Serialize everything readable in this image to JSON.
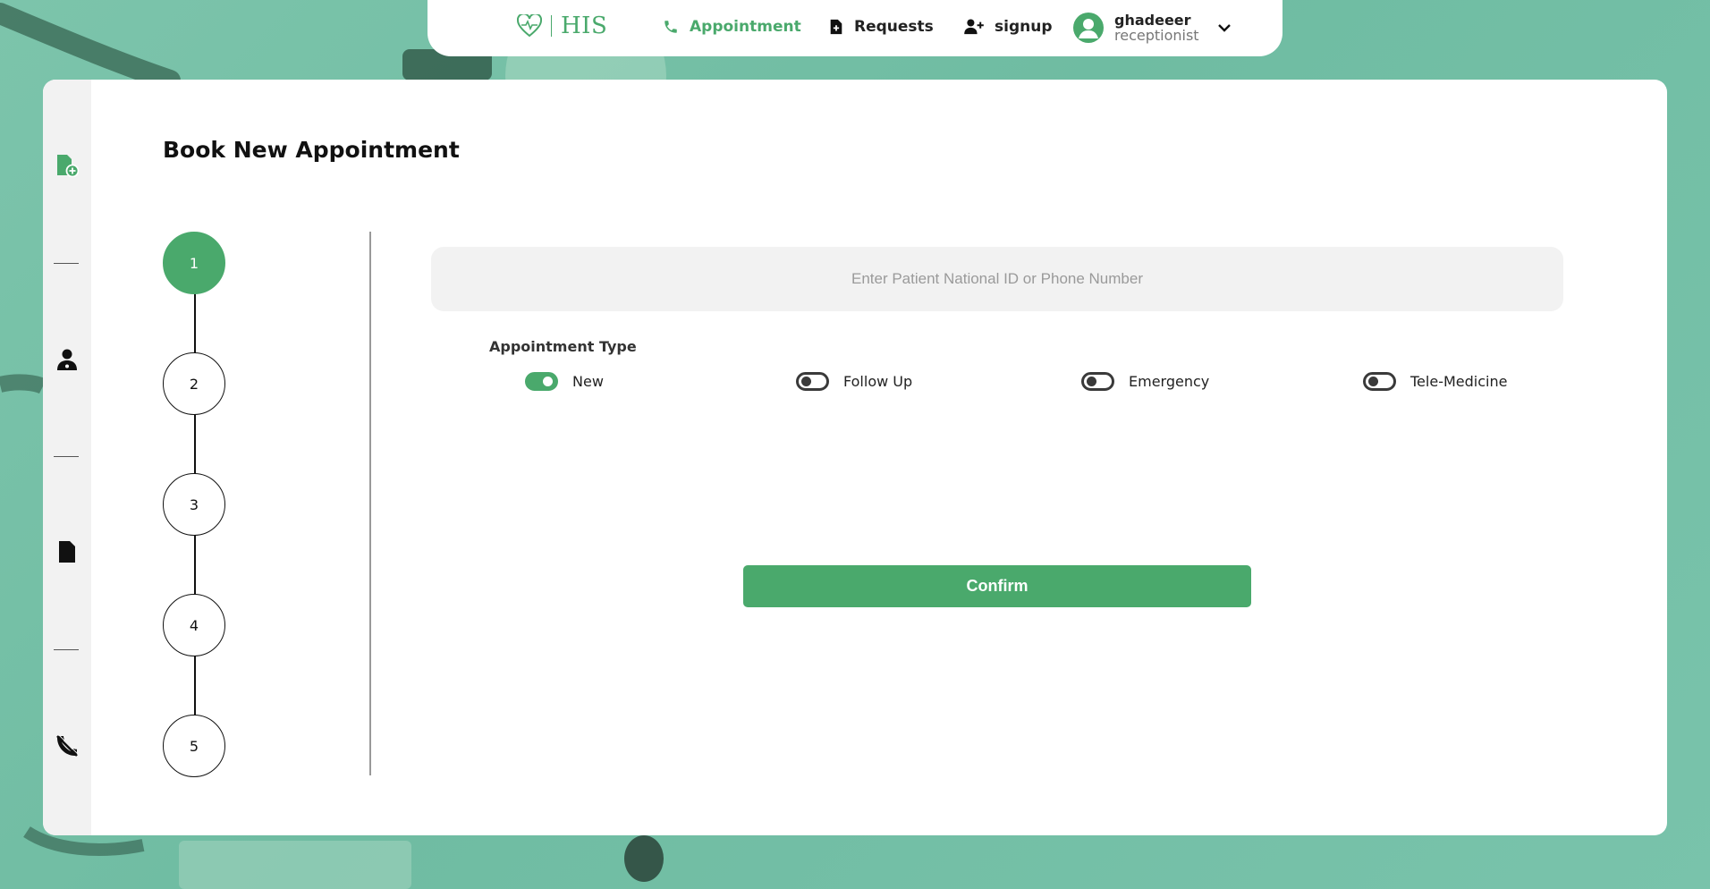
{
  "colors": {
    "brand": "#4aa96c",
    "text": "#111111",
    "muted": "#777777",
    "panel": "#f2f2f2"
  },
  "nav": {
    "logo_text": "HIS",
    "items": [
      {
        "label": "Appointment",
        "icon": "phone-icon",
        "active": true
      },
      {
        "label": "Requests",
        "icon": "file-plus-icon",
        "active": false
      },
      {
        "label": "signup",
        "icon": "user-plus-icon",
        "active": false
      }
    ],
    "user": {
      "name": "ghadeeer",
      "role": "receptionist"
    }
  },
  "sidebar": {
    "icons": [
      "file-add-icon",
      "doctor-icon",
      "document-icon",
      "phone-off-icon"
    ]
  },
  "page": {
    "title": "Book New Appointment",
    "steps": [
      "1",
      "2",
      "3",
      "4",
      "5"
    ],
    "active_step": "1",
    "search": {
      "placeholder": "Enter Patient National ID or Phone Number",
      "value": ""
    },
    "appointment_type": {
      "label": "Appointment Type",
      "options": [
        {
          "label": "New",
          "selected": true
        },
        {
          "label": "Follow Up",
          "selected": false
        },
        {
          "label": "Emergency",
          "selected": false
        },
        {
          "label": "Tele-Medicine",
          "selected": false
        }
      ]
    },
    "confirm_label": "Confirm"
  }
}
